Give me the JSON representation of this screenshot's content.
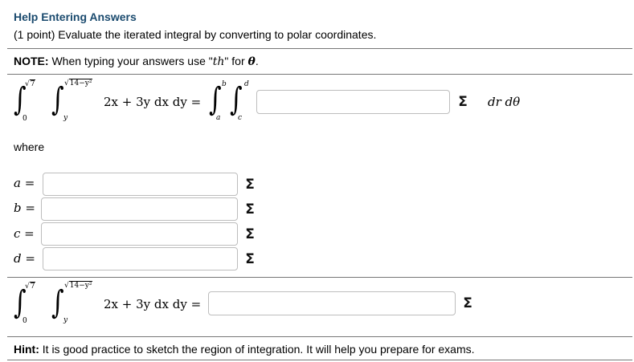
{
  "problem": {
    "help_link": "Help Entering Answers",
    "statement": "(1 point) Evaluate the iterated integral by converting to polar coordinates."
  },
  "note": {
    "label": "NOTE:",
    "text": "When typing your answers use \"th\" for θ.",
    "text_pre": "When typing your answers use \"",
    "code": "th",
    "text_mid": "\" for ",
    "theta": "θ",
    "text_post": "."
  },
  "integral": {
    "outer_lower": "0",
    "outer_upper": "√7",
    "outer_upper_radical": "7",
    "inner_lower": "y",
    "inner_upper": "√14−y²",
    "inner_upper_radical": "14−y²",
    "integrand": "2x + 3y dx dy =",
    "polar_outer_lower": "a",
    "polar_outer_upper": "b",
    "polar_inner_lower": "c",
    "polar_inner_upper": "d",
    "polar_suffix": "dr dθ"
  },
  "where_label": "where",
  "bounds": [
    {
      "label": "a =",
      "value": ""
    },
    {
      "label": "b =",
      "value": ""
    },
    {
      "label": "c =",
      "value": ""
    },
    {
      "label": "d =",
      "value": ""
    }
  ],
  "final": {
    "integrand": "2x + 3y dx dy =",
    "value": ""
  },
  "equation_editor_symbol": "Σ",
  "hint": {
    "label": "Hint:",
    "text": "It is good practice to sketch the region of integration. It will help you prepare for exams."
  }
}
